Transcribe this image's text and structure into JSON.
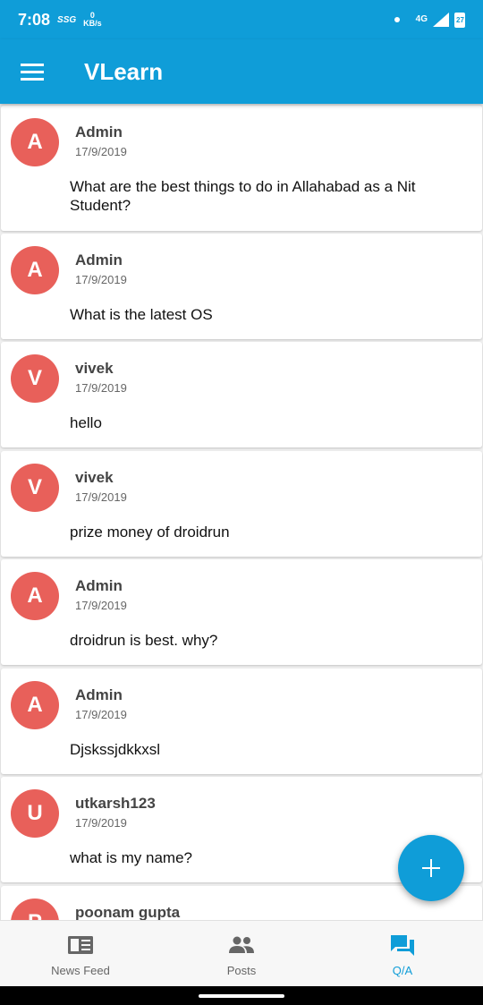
{
  "status": {
    "time": "7:08",
    "carrier": "SSG",
    "data_rate_value": "0",
    "data_rate_unit": "KB/s",
    "network": "4G",
    "battery": "27"
  },
  "app": {
    "title": "VLearn"
  },
  "posts": [
    {
      "initial": "A",
      "author": "Admin",
      "date": "17/9/2019",
      "text": "What are the best things to do in Allahabad as a Nit Student?"
    },
    {
      "initial": "A",
      "author": "Admin",
      "date": "17/9/2019",
      "text": "What is the latest OS"
    },
    {
      "initial": "V",
      "author": "vivek",
      "date": "17/9/2019",
      "text": "hello"
    },
    {
      "initial": "V",
      "author": "vivek",
      "date": "17/9/2019",
      "text": "prize money of droidrun"
    },
    {
      "initial": "A",
      "author": "Admin",
      "date": "17/9/2019",
      "text": "droidrun is best. why?"
    },
    {
      "initial": "A",
      "author": "Admin",
      "date": "17/9/2019",
      "text": "Djskssjdkkxsl"
    },
    {
      "initial": "U",
      "author": "utkarsh123",
      "date": "17/9/2019",
      "text": "what is my name?"
    },
    {
      "initial": "P",
      "author": "poonam gupta",
      "date": "",
      "text": ""
    }
  ],
  "nav": {
    "news_feed": "News Feed",
    "posts": "Posts",
    "qa": "Q/A"
  },
  "colors": {
    "primary": "#0f9dd8",
    "avatar": "#e8605a"
  }
}
